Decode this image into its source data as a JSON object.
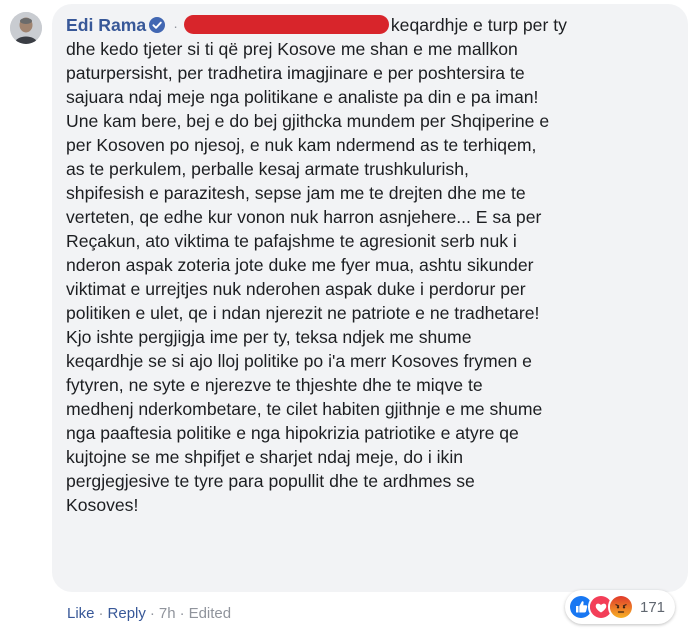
{
  "comment": {
    "author": "Edi Rama",
    "lines": [
      "keqardhje e turp per ty",
      "dhe kedo tjeter si ti që prej Kosove me shan e me mallkon",
      "paturpersisht, per tradhetira imagjinare e per poshtersira te",
      "sajuara ndaj meje nga politikane e analiste pa din e pa iman!",
      "Une kam bere, bej e do bej gjithcka mundem per Shqiperine e",
      "per Kosoven po njesoj, e nuk kam ndermend as te terhiqem,",
      "as te perkulem, perballe kesaj armate trushkulurish,",
      "shpifesish e parazitesh, sepse jam me te drejten dhe me te",
      "verteten, qe edhe kur vonon nuk harron asnjehere... E sa per",
      "Reçakun, ato viktima te pafajshme te agresionit serb nuk i",
      "nderon aspak zoteria jote duke me fyer mua, ashtu sikunder",
      "viktimat e urrejtjes nuk nderohen aspak duke i perdorur per",
      "politiken e ulet, qe i ndan njerezit ne patriote e ne tradhetare!",
      "Kjo ishte pergjigja ime per ty, teksa ndjek me shume",
      "keqardhje se si ajo lloj politike po i'a merr Kosoves frymen e",
      "fytyren, ne syte e njerezve te thjeshte dhe te miqve te",
      "medhenj nderkombetare, te cilet habiten gjithnje e me shume",
      "nga paaftesia politike e nga hipokrizia patriotike e atyre qe",
      "kujtojne se me shpifjet e sharjet ndaj meje, do i ikin",
      "pergjegjesive te tyre para popullit dhe te ardhmes se",
      "Kosoves!"
    ]
  },
  "actions": {
    "like": "Like",
    "reply": "Reply",
    "time": "7h",
    "edited": "Edited",
    "sep": "·"
  },
  "reactions": {
    "count": "171",
    "icons": [
      "like-icon",
      "love-icon",
      "angry-icon"
    ]
  },
  "colors": {
    "author": "#385898",
    "bubble": "#f2f3f5",
    "redaction": "#d8252b",
    "like": "#1877f2",
    "love": "#f33e58",
    "angry": "#e9710f"
  }
}
